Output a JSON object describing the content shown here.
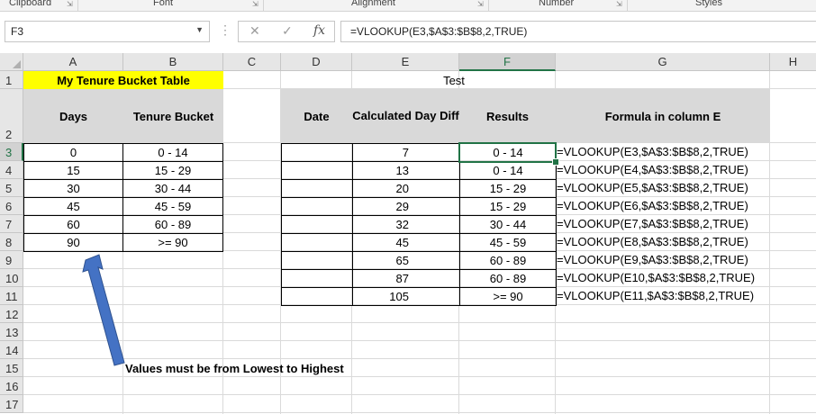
{
  "ribbon": {
    "groups": [
      "Clipboard",
      "Font",
      "Alignment",
      "Number",
      "Styles"
    ]
  },
  "formula_bar": {
    "name_box": "F3",
    "cancel_icon": "✕",
    "enter_icon": "✓",
    "fx_label": "fx",
    "formula": "=VLOOKUP(E3,$A$3:$B$8,2,TRUE)"
  },
  "columns": [
    "A",
    "B",
    "C",
    "D",
    "E",
    "F",
    "G",
    "H"
  ],
  "rows": [
    "1",
    "2",
    "3",
    "4",
    "5",
    "6",
    "7",
    "8",
    "9",
    "10",
    "11",
    "12",
    "13",
    "14",
    "15",
    "16",
    "17"
  ],
  "bucket_table": {
    "title": "My Tenure Bucket Table",
    "headers": [
      "Days",
      "Tenure Bucket"
    ],
    "rows": [
      [
        "0",
        "0 - 14"
      ],
      [
        "15",
        "15 - 29"
      ],
      [
        "30",
        "30 - 44"
      ],
      [
        "45",
        "45 - 59"
      ],
      [
        "60",
        "60 - 89"
      ],
      [
        "90",
        ">= 90"
      ]
    ]
  },
  "test_table": {
    "title": "Test",
    "headers": [
      "Date",
      "Calculated Day Diff",
      "Results",
      "Formula in column E"
    ],
    "rows": [
      [
        "",
        "7",
        "0 - 14",
        "=VLOOKUP(E3,$A$3:$B$8,2,TRUE)"
      ],
      [
        "",
        "13",
        "0 - 14",
        "=VLOOKUP(E4,$A$3:$B$8,2,TRUE)"
      ],
      [
        "",
        "20",
        "15 - 29",
        "=VLOOKUP(E5,$A$3:$B$8,2,TRUE)"
      ],
      [
        "",
        "29",
        "15 - 29",
        "=VLOOKUP(E6,$A$3:$B$8,2,TRUE)"
      ],
      [
        "",
        "32",
        "30 - 44",
        "=VLOOKUP(E7,$A$3:$B$8,2,TRUE)"
      ],
      [
        "",
        "45",
        "45 - 59",
        "=VLOOKUP(E8,$A$3:$B$8,2,TRUE)"
      ],
      [
        "",
        "65",
        "60 - 89",
        "=VLOOKUP(E9,$A$3:$B$8,2,TRUE)"
      ],
      [
        "",
        "87",
        "60 - 89",
        "=VLOOKUP(E10,$A$3:$B$8,2,TRUE)"
      ],
      [
        "",
        "105",
        ">= 90",
        "=VLOOKUP(E11,$A$3:$B$8,2,TRUE)"
      ]
    ]
  },
  "annotation": {
    "text": "Values must be from Lowest to Highest",
    "arrow_color": "#4472c4"
  },
  "colors": {
    "accent": "#217346",
    "title_fill": "#ffff00",
    "header_fill": "#d9d9d9"
  }
}
